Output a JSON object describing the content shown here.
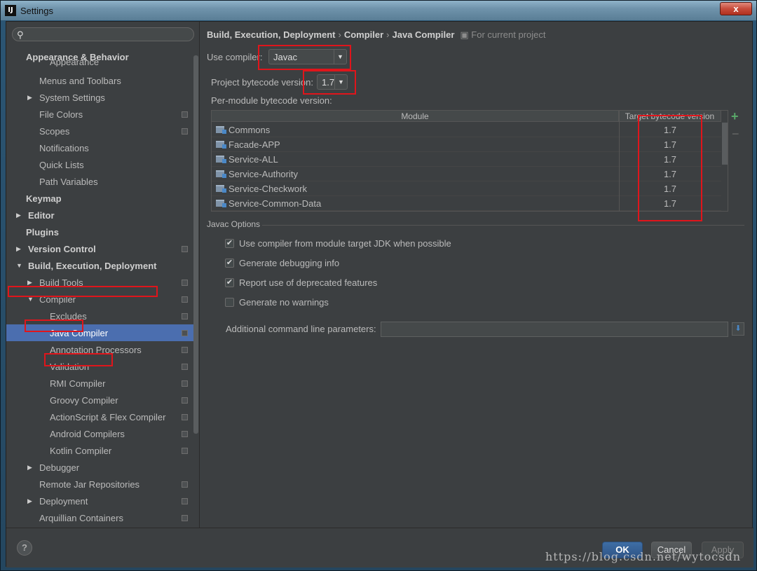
{
  "window": {
    "title": "Settings",
    "app_icon": "IJ",
    "close": "x"
  },
  "sidebar": {
    "search_placeholder": "",
    "items": [
      {
        "label": "Appearance & Behavior",
        "bold": true
      },
      {
        "label": "Appearance"
      },
      {
        "label": "Menus and Toolbars"
      },
      {
        "label": "System Settings",
        "arrow": "▶"
      },
      {
        "label": "File Colors",
        "project": true
      },
      {
        "label": "Scopes",
        "project": true
      },
      {
        "label": "Notifications"
      },
      {
        "label": "Quick Lists"
      },
      {
        "label": "Path Variables"
      },
      {
        "label": "Keymap",
        "bold": true
      },
      {
        "label": "Editor",
        "bold": true,
        "arrow": "▶"
      },
      {
        "label": "Plugins",
        "bold": true
      },
      {
        "label": "Version Control",
        "bold": true,
        "arrow": "▶",
        "project": true
      },
      {
        "label": "Build, Execution, Deployment",
        "bold": true,
        "arrow": "▼"
      },
      {
        "label": "Build Tools",
        "arrow": "▶",
        "project": true
      },
      {
        "label": "Compiler",
        "arrow": "▼",
        "project": true
      },
      {
        "label": "Excludes",
        "project": true
      },
      {
        "label": "Java Compiler",
        "project": true,
        "selected": true
      },
      {
        "label": "Annotation Processors",
        "project": true
      },
      {
        "label": "Validation",
        "project": true
      },
      {
        "label": "RMI Compiler",
        "project": true
      },
      {
        "label": "Groovy Compiler",
        "project": true
      },
      {
        "label": "ActionScript & Flex Compiler",
        "project": true
      },
      {
        "label": "Android Compilers",
        "project": true
      },
      {
        "label": "Kotlin Compiler",
        "project": true
      },
      {
        "label": "Debugger",
        "arrow": "▶"
      },
      {
        "label": "Remote Jar Repositories",
        "project": true
      },
      {
        "label": "Deployment",
        "arrow": "▶",
        "project": true
      },
      {
        "label": "Arquillian Containers",
        "project": true
      }
    ]
  },
  "breadcrumb": {
    "part1": "Build, Execution, Deployment",
    "part2": "Compiler",
    "part3": "Java Compiler",
    "sep": "›",
    "scope": "For current project"
  },
  "compiler": {
    "use_compiler_label": "Use compiler:",
    "use_compiler_value": "Javac",
    "bytecode_label": "Project bytecode version:",
    "bytecode_value": "1.7",
    "per_module_label": "Per-module bytecode version:"
  },
  "module_table": {
    "headers": [
      "Module",
      "Target bytecode version"
    ],
    "rows": [
      {
        "module": "Commons",
        "version": "1.7"
      },
      {
        "module": "Facade-APP",
        "version": "1.7"
      },
      {
        "module": "Service-ALL",
        "version": "1.7"
      },
      {
        "module": "Service-Authority",
        "version": "1.7"
      },
      {
        "module": "Service-Checkwork",
        "version": "1.7"
      },
      {
        "module": "Service-Common-Data",
        "version": "1.7"
      }
    ],
    "add": "+",
    "remove": "−"
  },
  "javac_options": {
    "title": "Javac Options",
    "options": [
      {
        "label": "Use compiler from module target JDK when possible",
        "checked": true
      },
      {
        "label": "Generate debugging info",
        "checked": true
      },
      {
        "label": "Report use of deprecated features",
        "checked": true
      },
      {
        "label": "Generate no warnings",
        "checked": false
      }
    ],
    "params_label": "Additional command line parameters:",
    "params_value": ""
  },
  "footer": {
    "help": "?",
    "ok": "OK",
    "cancel": "Cancel",
    "apply": "Apply"
  },
  "watermark": "https://blog.csdn.net/wytocsdn",
  "colors": {
    "selection": "#4b6eaf",
    "highlight_box": "#e0151b",
    "add_green": "#59a869"
  }
}
